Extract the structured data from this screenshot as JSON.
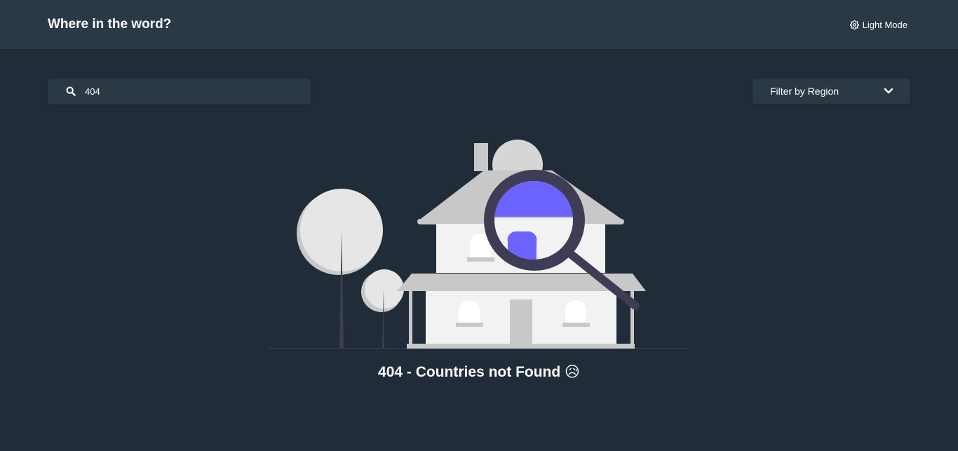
{
  "header": {
    "title": "Where in the word?",
    "theme_toggle_label": "Light Mode",
    "theme_toggle_icon": "gear-icon"
  },
  "search": {
    "value": "404",
    "icon": "search-icon"
  },
  "filter": {
    "label": "Filter by Region",
    "icon": "chevron-down-icon"
  },
  "empty_state": {
    "message": "404 - Countries not Found 😥",
    "illustration": "house-with-magnifying-glass"
  },
  "colors": {
    "background": "#202c37",
    "surface": "#2b3945",
    "text": "#ffffff",
    "accent": "#6c63ff"
  }
}
